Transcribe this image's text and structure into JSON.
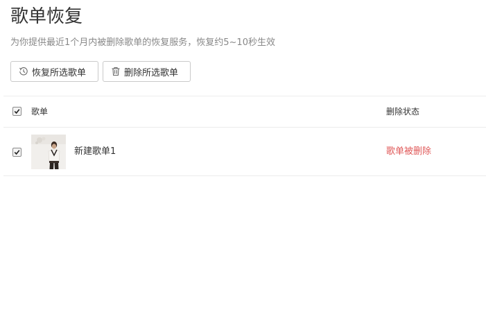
{
  "page": {
    "title": "歌单恢复",
    "subtitle": "为你提供最近1个月内被删除歌单的恢复服务，恢复约5~10秒生效"
  },
  "toolbar": {
    "restore_label": "恢复所选歌单",
    "restore_icon": "history-icon",
    "delete_label": "删除所选歌单",
    "delete_icon": "trash-icon"
  },
  "table": {
    "header": {
      "select_all_checked": true,
      "name_column": "歌单",
      "status_column": "删除状态"
    },
    "rows": [
      {
        "checked": true,
        "name": "新建歌单1",
        "status": "歌单被删除",
        "status_color": "#e05a5a",
        "cover": "album-cover-image"
      }
    ]
  },
  "colors": {
    "text": "#333333",
    "muted": "#888888",
    "border": "#c9c9c9",
    "divider": "#ececec",
    "danger": "#e05a5a"
  }
}
